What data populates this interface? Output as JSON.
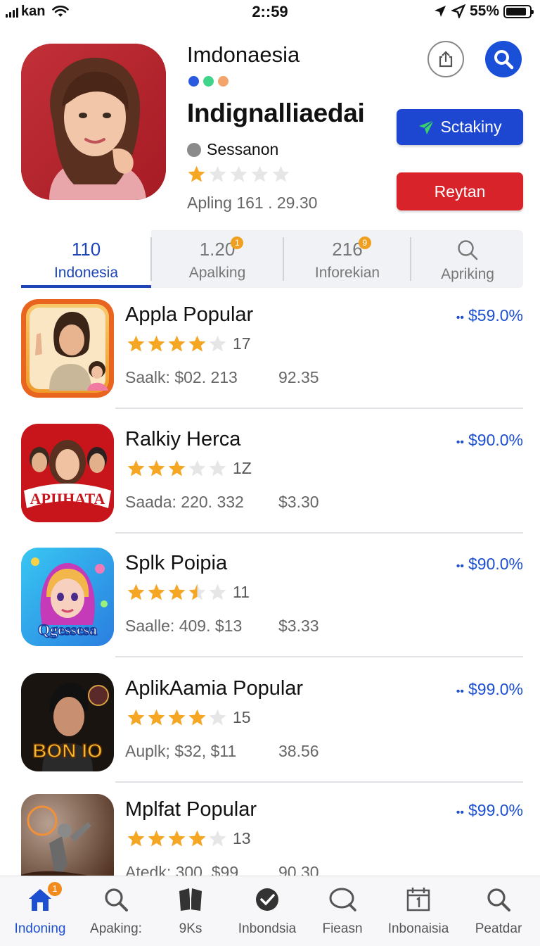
{
  "status_bar": {
    "carrier": "kan",
    "time": "2::59",
    "battery": "55%"
  },
  "header": {
    "app_name": "Imdonaesia",
    "title": "Indignalliaedai",
    "session_label": "Sessanon",
    "rating": 1,
    "meta": "Apling 161 .  29.30",
    "primary_button": "Sctakiny",
    "secondary_button": "Reytan",
    "accent_colors": [
      "#2a5ae0",
      "#3ed48a",
      "#f2a46a"
    ]
  },
  "tabs": [
    {
      "number": "110",
      "label": "Indonesia",
      "badge": ""
    },
    {
      "number": "1.20",
      "label": "Apalking",
      "badge": "1"
    },
    {
      "number": "216",
      "label": "Inforekian",
      "badge": "9"
    },
    {
      "number": "",
      "label": "Apriking",
      "badge": ""
    }
  ],
  "apps": [
    {
      "title": "Appla Popular",
      "rating": 4,
      "count": "17",
      "stat1": "Saalk: $02. 213",
      "stat2": "92.35",
      "price": "$59.0%",
      "icon_text": ""
    },
    {
      "title": "Ralkiy Herca",
      "rating": 3,
      "count": "1Z",
      "stat1": "Saada: 220. 332",
      "stat2": "$3.30",
      "price": "$90.0%",
      "icon_text": "APIIHATA"
    },
    {
      "title": "Splk Poipia",
      "rating": 3.5,
      "count": "11",
      "stat1": "Saalle: 409. $13",
      "stat2": "$3.33",
      "price": "$90.0%",
      "icon_text": "Qgessesa"
    },
    {
      "title": "AplikAamia Popular",
      "rating": 4,
      "count": "15",
      "stat1": "Auplk; $32, $11",
      "stat2": "38.56",
      "price": "$99.0%",
      "icon_text": "BON IO"
    },
    {
      "title": "Mplfat Popular",
      "rating": 4,
      "count": "13",
      "stat1": "Atedk: 300. $99",
      "stat2": "90.30",
      "price": "$99.0%",
      "icon_text": ""
    }
  ],
  "bottom_nav": [
    {
      "label": "Indoning",
      "icon": "home-icon",
      "badge": "1"
    },
    {
      "label": "Apaking:",
      "icon": "search-icon",
      "badge": ""
    },
    {
      "label": "9Ks",
      "icon": "book-icon",
      "badge": ""
    },
    {
      "label": "Inbondsia",
      "icon": "check-badge-icon",
      "badge": ""
    },
    {
      "label": "Fieasn",
      "icon": "search-icon",
      "badge": ""
    },
    {
      "label": "Inbonaisia",
      "icon": "calendar-icon",
      "badge": ""
    },
    {
      "label": "Peatdar",
      "icon": "search-icon",
      "badge": ""
    }
  ]
}
